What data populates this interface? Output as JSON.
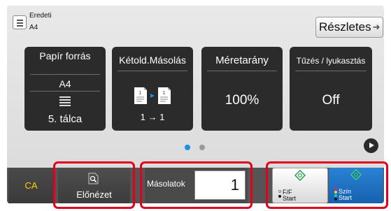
{
  "header": {
    "original_label": "Eredeti",
    "original_size": "A4",
    "details_label": "Részletes"
  },
  "tiles": [
    {
      "title": "Papír forrás",
      "sub": "A4",
      "value": "5. tálca",
      "icon": "paper-tray-icon"
    },
    {
      "title": "Kétold.Másolás",
      "value": "1 → 1",
      "icon": "duplex-copy-icon"
    },
    {
      "title": "Méretarány",
      "value": "100%"
    },
    {
      "title": "Tűzés / lyukasztás",
      "value": "Off"
    }
  ],
  "pagination": {
    "pages": 2,
    "current": 1
  },
  "bottom": {
    "ca_label": "CA",
    "preview_label": "Előnézet",
    "copies_label": "Másolatok",
    "copies_value": "1",
    "bw_start_line1": "F/F",
    "bw_start_line2": "Start",
    "color_start_line1": "Szín",
    "color_start_line2": "Start"
  },
  "colors": {
    "tile_bg": "#2b2b2b",
    "highlight_frame": "#e3001b",
    "ca_text": "#ffd200",
    "color_start": "#1d6cc0",
    "active_dot": "#1d8fe0"
  }
}
